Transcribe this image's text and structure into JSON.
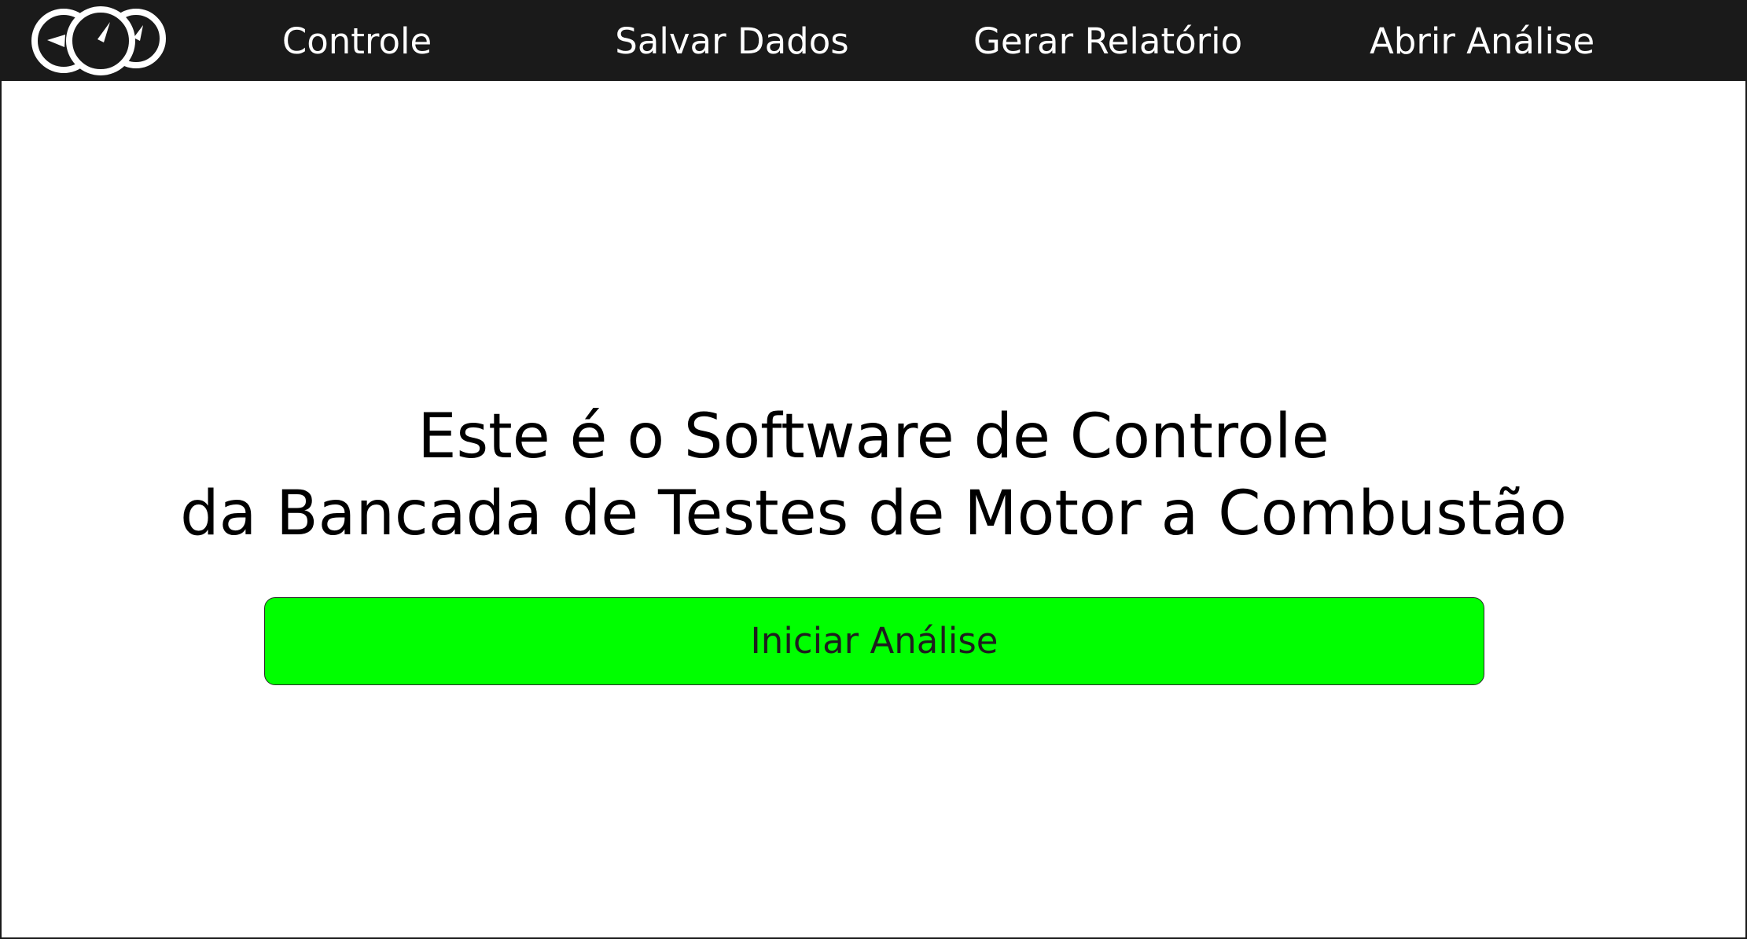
{
  "nav": {
    "logo_icon": "gauges-icon",
    "items": [
      {
        "label": "Controle"
      },
      {
        "label": "Salvar Dados"
      },
      {
        "label": "Gerar Relatório"
      },
      {
        "label": "Abrir Análise"
      }
    ]
  },
  "main": {
    "headline_line1": "Este é o Software de Controle",
    "headline_line2": "da Bancada de Testes de Motor a Combustão",
    "start_button_label": "Iniciar Análise"
  },
  "colors": {
    "navbar_bg": "#1a1a1a",
    "nav_text": "#ffffff",
    "button_bg": "#00ff00",
    "page_bg": "#ffffff"
  }
}
